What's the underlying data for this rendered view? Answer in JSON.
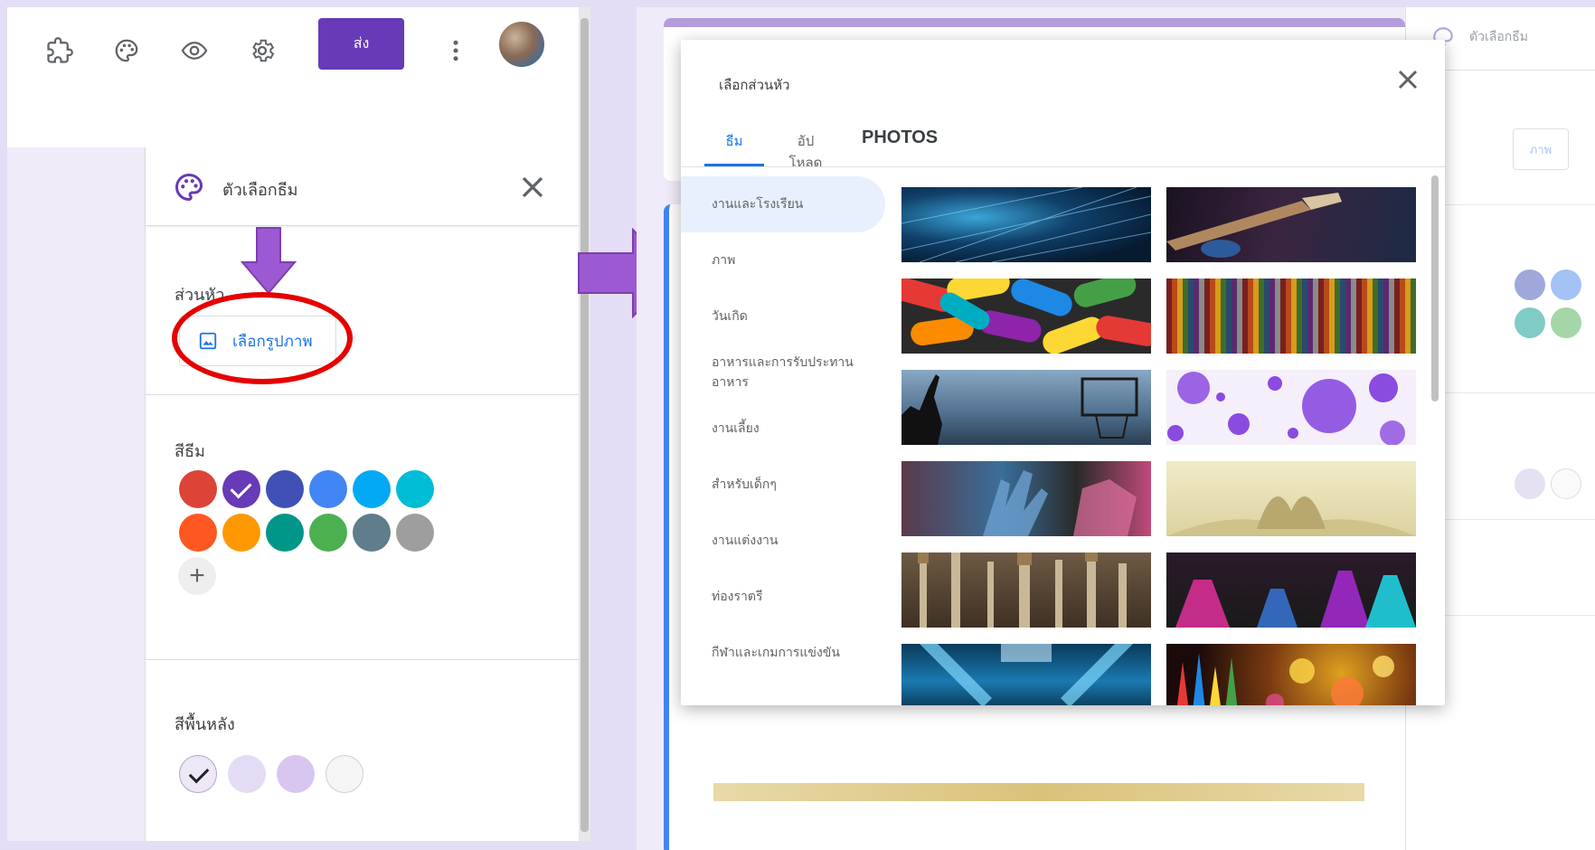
{
  "left": {
    "toolbar": {
      "icons": [
        "puzzle-icon",
        "palette-icon",
        "eye-icon",
        "gear-icon",
        "more-vert-icon"
      ],
      "send_label": "ส่ง"
    },
    "theme_panel": {
      "title": "ตัวเลือกธีม",
      "header_section_label": "ส่วนหัว",
      "choose_image_label": "เลือกรูปภาพ",
      "theme_color_label": "สีธีม",
      "theme_colors": [
        "#db4437",
        "#673ab7",
        "#3f51b5",
        "#4285f4",
        "#03a9f4",
        "#00bcd4",
        "#ff5722",
        "#ff9800",
        "#009688",
        "#4caf50",
        "#607d8b",
        "#9e9e9e"
      ],
      "selected_theme_color": "#673ab7",
      "background_color_label": "สีพื้นหลัง",
      "background_colors": [
        "#ede7f6",
        "#e4dbf5",
        "#d7c6f0",
        "#f5f5f5"
      ],
      "selected_background_color": "#ede7f6"
    },
    "annotations": {
      "arrow_color": "#9c59d1",
      "ellipse_color": "#e60000"
    }
  },
  "right": {
    "background_panel_title": "ตัวเลือกธีม",
    "background_panel_button": "ภาพ",
    "dialog": {
      "title": "เลือกส่วนหัว",
      "tabs": [
        "ธีม",
        "อัปโหลด",
        "PHOTOS"
      ],
      "active_tab": "ธีม",
      "categories": [
        "งานและโรงเรียน",
        "ภาพ",
        "วันเกิด",
        "อาหารและการรับประทานอาหาร",
        "งานเลี้ยง",
        "สำหรับเด็กๆ",
        "งานแต่งงาน",
        "ท่องราตรี",
        "กีฬาและเกมการแข่งขัน"
      ],
      "active_category": "งานและโรงเรียน",
      "thumbnails": [
        "fiber-optic-lights",
        "guitar-player",
        "colorful-pills",
        "colored-threads",
        "basketball-hoop",
        "purple-bubbles",
        "painted-hands",
        "open-book-heart",
        "paint-brushes",
        "chemistry-flasks",
        "microscope",
        "colored-pencils-bokeh"
      ]
    }
  }
}
